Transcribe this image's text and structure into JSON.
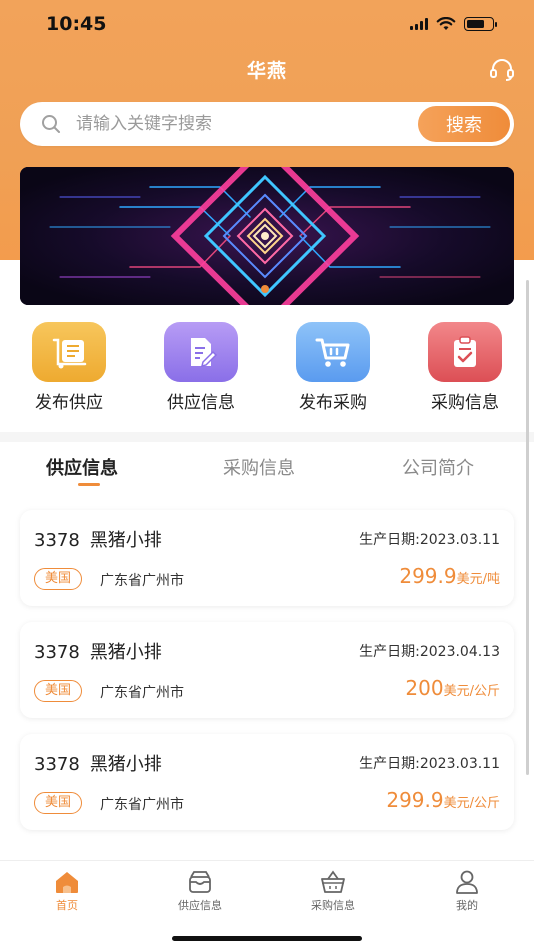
{
  "status_bar": {
    "time": "10:45"
  },
  "nav": {
    "title": "华燕",
    "support_icon": "headset-icon"
  },
  "search": {
    "placeholder": "请输入关键字搜索",
    "button_label": "搜索"
  },
  "banner": {
    "image": "abstract-neon-circuit-banner"
  },
  "quick_menu": [
    {
      "label": "发布供应",
      "icon": "publish-supply-icon",
      "color": "#f2b540"
    },
    {
      "label": "供应信息",
      "icon": "supply-info-icon",
      "color": "#9a80ee"
    },
    {
      "label": "发布采购",
      "icon": "cart-icon",
      "color": "#6aa8f2"
    },
    {
      "label": "采购信息",
      "icon": "clipboard-check-icon",
      "color": "#e4626a"
    }
  ],
  "tabs": [
    {
      "label": "供应信息",
      "active": true
    },
    {
      "label": "采购信息",
      "active": false
    },
    {
      "label": "公司简介",
      "active": false
    }
  ],
  "listings": [
    {
      "code": "3378",
      "name": "黑猪小排",
      "date": "生产日期:2023.03.11",
      "badge": "美国",
      "location": "广东省广州市",
      "price": "299.9",
      "unit": "美元/吨"
    },
    {
      "code": "3378",
      "name": "黑猪小排",
      "date": "生产日期:2023.04.13",
      "badge": "美国",
      "location": "广东省广州市",
      "price": "200",
      "unit": "美元/公斤"
    },
    {
      "code": "3378",
      "name": "黑猪小排",
      "date": "生产日期:2023.03.11",
      "badge": "美国",
      "location": "广东省广州市",
      "price": "299.9",
      "unit": "美元/公斤"
    }
  ],
  "tabbar": [
    {
      "label": "首页",
      "icon": "home-icon",
      "active": true
    },
    {
      "label": "供应信息",
      "icon": "inbox-icon",
      "active": false
    },
    {
      "label": "采购信息",
      "icon": "basket-icon",
      "active": false
    },
    {
      "label": "我的",
      "icon": "user-icon",
      "active": false
    }
  ],
  "colors": {
    "accent": "#ef8c3a",
    "header_gradient": "#f2a35a"
  }
}
